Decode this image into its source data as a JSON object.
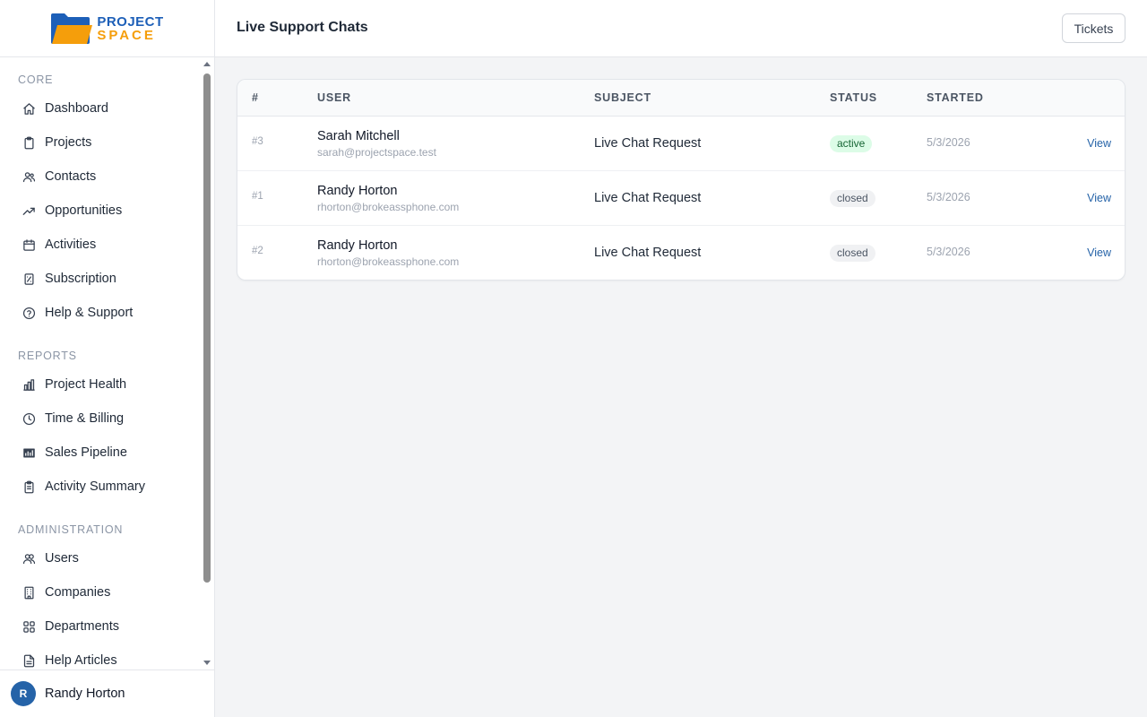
{
  "brand": {
    "line1": "PROJECT",
    "line2": "SPACE",
    "colors": {
      "primary": "#1d5fb8",
      "accent": "#f59e0b"
    }
  },
  "sidebar": {
    "sections": [
      {
        "title": "CORE",
        "items": [
          {
            "label": "Dashboard",
            "icon": "home-icon"
          },
          {
            "label": "Projects",
            "icon": "clipboard-icon"
          },
          {
            "label": "Contacts",
            "icon": "users-icon"
          },
          {
            "label": "Opportunities",
            "icon": "trending-up-icon"
          },
          {
            "label": "Activities",
            "icon": "calendar-icon"
          },
          {
            "label": "Subscription",
            "icon": "receipt-icon"
          },
          {
            "label": "Help & Support",
            "icon": "help-circle-icon"
          }
        ]
      },
      {
        "title": "REPORTS",
        "items": [
          {
            "label": "Project Health",
            "icon": "bar-chart-icon"
          },
          {
            "label": "Time & Billing",
            "icon": "clock-icon"
          },
          {
            "label": "Sales Pipeline",
            "icon": "pipeline-icon"
          },
          {
            "label": "Activity Summary",
            "icon": "clipboard-list-icon"
          }
        ]
      },
      {
        "title": "ADMINISTRATION",
        "items": [
          {
            "label": "Users",
            "icon": "user-group-icon"
          },
          {
            "label": "Companies",
            "icon": "building-icon"
          },
          {
            "label": "Departments",
            "icon": "grid-icon"
          },
          {
            "label": "Help Articles",
            "icon": "document-icon"
          }
        ]
      }
    ]
  },
  "user": {
    "initial": "R",
    "name": "Randy Horton"
  },
  "header": {
    "title": "Live Support Chats",
    "tickets_label": "Tickets"
  },
  "table": {
    "columns": [
      "#",
      "USER",
      "SUBJECT",
      "STATUS",
      "STARTED"
    ],
    "rows": [
      {
        "id": "#3",
        "name": "Sarah Mitchell",
        "email": "sarah@projectspace.test",
        "subject": "Live Chat Request",
        "status": "active",
        "started": "5/3/2026",
        "action": "View"
      },
      {
        "id": "#1",
        "name": "Randy Horton",
        "email": "rhorton@brokeassphone.com",
        "subject": "Live Chat Request",
        "status": "closed",
        "started": "5/3/2026",
        "action": "View"
      },
      {
        "id": "#2",
        "name": "Randy Horton",
        "email": "rhorton@brokeassphone.com",
        "subject": "Live Chat Request",
        "status": "closed",
        "started": "5/3/2026",
        "action": "View"
      }
    ]
  },
  "status_colors": {
    "active": {
      "bg": "#dcfce7",
      "fg": "#166534"
    },
    "closed": {
      "bg": "#f0f1f3",
      "fg": "#4b5563"
    }
  }
}
